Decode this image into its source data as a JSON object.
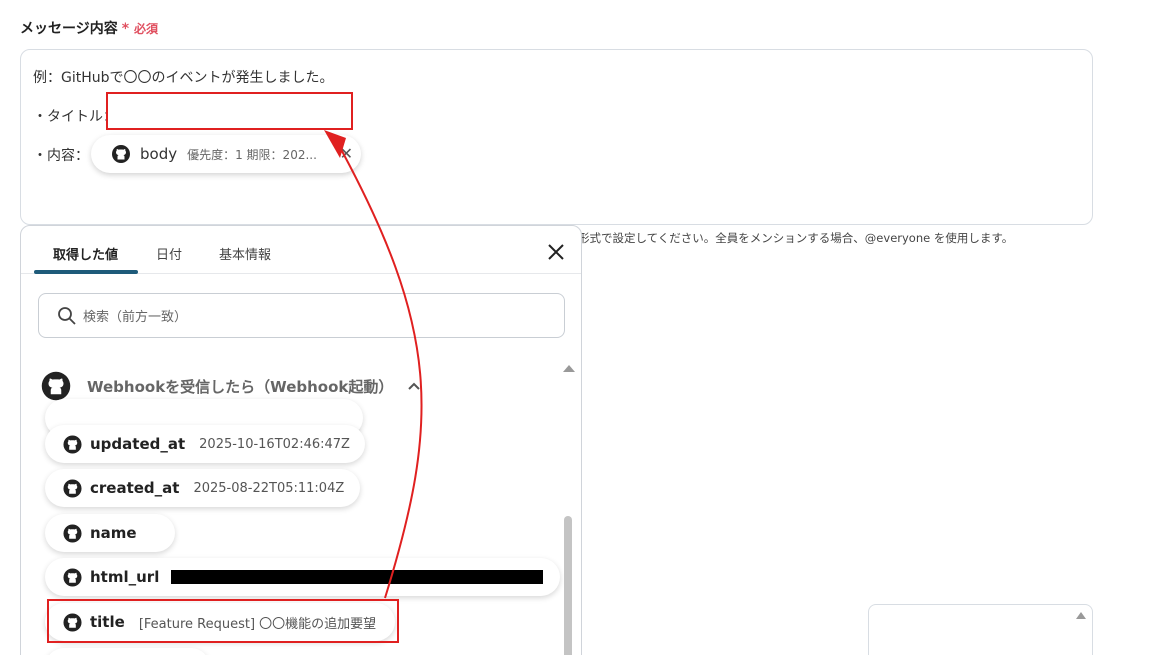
{
  "field": {
    "label": "メッセージ内容",
    "required_mark": "*",
    "required_text": "必須"
  },
  "message": {
    "line1": "例：GitHubで〇〇のイベントが発生しました。",
    "line2": "・タイトル：",
    "line3": "・内容："
  },
  "chip_body": {
    "name": "body",
    "value": "優先度：1 期限：202..."
  },
  "hint": "形式で設定してください。全員をメンションする場合、@everyone を使用します。",
  "panel": {
    "tabs": [
      {
        "label": "取得した値"
      },
      {
        "label": "日付"
      },
      {
        "label": "基本情報"
      }
    ],
    "search_placeholder": "検索（前方一致）",
    "section_title": "Webhookを受信したら（Webhook起動）",
    "items": [
      {
        "key": "updated_at",
        "value": "2025-10-16T02:46:47Z"
      },
      {
        "key": "created_at",
        "value": "2025-08-22T05:11:04Z"
      },
      {
        "key": "name",
        "value": ""
      },
      {
        "key": "html_url",
        "value": ""
      },
      {
        "key": "title",
        "value": "[Feature Request] 〇〇機能の追加要望"
      }
    ]
  },
  "colors": {
    "accent": "#1e5b7a",
    "required": "#e05060",
    "annotation": "#e02020"
  },
  "icons": {
    "item_icon": "github-icon",
    "close": "close-icon",
    "search": "search-icon",
    "caret": "chevron-up-icon"
  }
}
